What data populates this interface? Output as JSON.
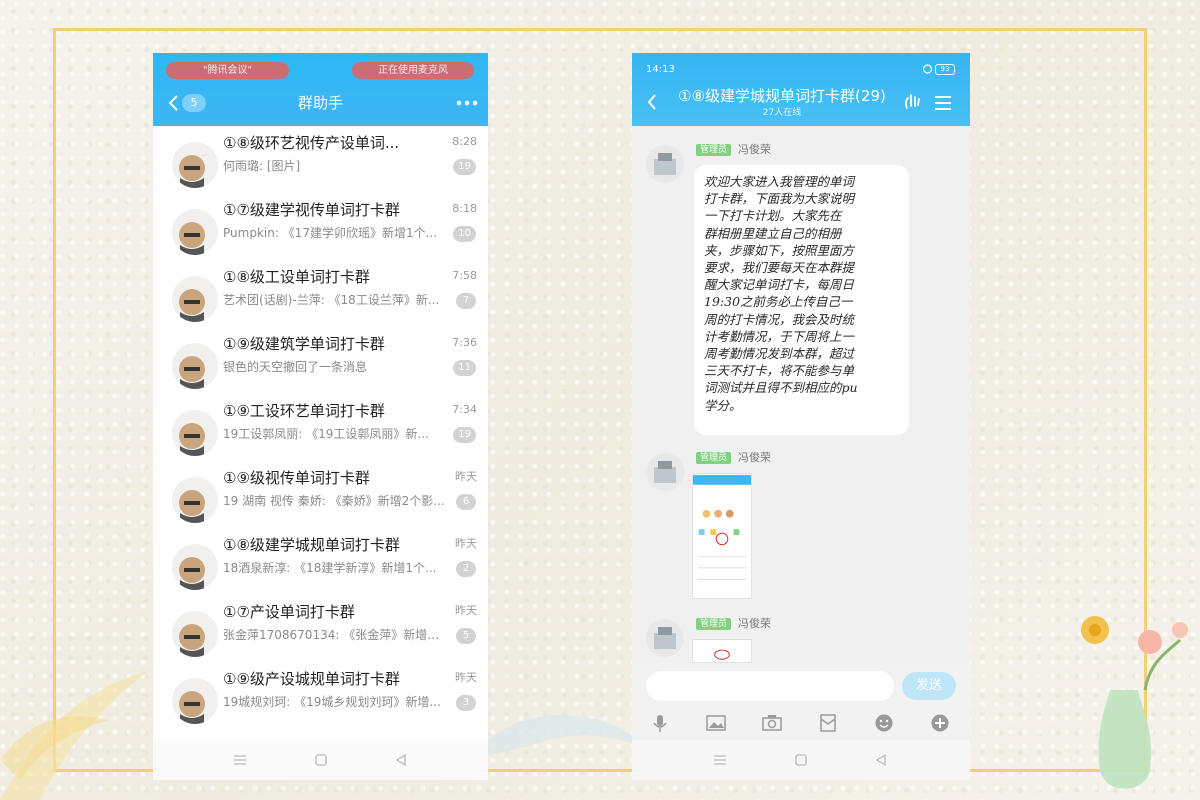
{
  "left_phone": {
    "header": {
      "pill_left": "\"腾讯会议\"",
      "pill_right": "正在使用麦克风",
      "back_badge": "5",
      "title": "群助手"
    },
    "conversations": [
      {
        "name": "①⑧级环艺视传产设单词...",
        "preview": "何雨璐: [图片]",
        "time": "8:28",
        "count": "19"
      },
      {
        "name": "①⑦级建学视传单词打卡群",
        "preview": "Pumpkin: 《17建学卯欣瑶》新增1个...",
        "time": "8:18",
        "count": "10"
      },
      {
        "name": "①⑧级工设单词打卡群",
        "preview": "艺术团(话剧)-兰萍: 《18工设兰萍》新...",
        "time": "7:58",
        "count": "7"
      },
      {
        "name": "①⑨级建筑学单词打卡群",
        "preview": "银色的天空撤回了一条消息",
        "time": "7:36",
        "count": "11"
      },
      {
        "name": "①⑨工设环艺单词打卡群",
        "preview": "19工设郭凤丽: 《19工设郭凤丽》新...",
        "time": "7:34",
        "count": "19"
      },
      {
        "name": "①⑨级视传单词打卡群",
        "preview": "19 湖南 视传 秦娇: 《秦娇》新增2个影...",
        "time": "昨天",
        "count": "6"
      },
      {
        "name": "①⑧级建学城规单词打卡群",
        "preview": "18酒泉新淳: 《18建学新淳》新增1个...",
        "time": "昨天",
        "count": "2"
      },
      {
        "name": "①⑦产设单词打卡群",
        "preview": "张金萍1708670134: 《张金萍》新增1个...",
        "time": "昨天",
        "count": "5"
      },
      {
        "name": "①⑨级产设城规单词打卡群",
        "preview": "19城规刘珂: 《19城乡规划刘珂》新增...",
        "time": "昨天",
        "count": "3"
      }
    ]
  },
  "right_phone": {
    "status": {
      "time": "14:13",
      "battery": "93"
    },
    "header": {
      "title": "①⑧级建学城规单词打卡群(29)",
      "online": "27人在线"
    },
    "messages": [
      {
        "role": "管理员",
        "sender": "冯俊荣",
        "lines": [
          "欢迎大家进入我管理的单词",
          "打卡群，下面我为大家说明",
          "一下打卡计划。大家先在",
          "群相册里建立自己的相册",
          "夹，步骤如下，按照里面方",
          "要求，我们要每天在本群提",
          "醒大家记单词打卡，每周日",
          "19:30之前务必上传自己一",
          "周的打卡情况，我会及时统",
          "计考勤情况，于下周将上一",
          "周考勤情况发到本群，超过",
          "三天不打卡，将不能参与单",
          "词测试并且得不到相应的pu",
          "学分。"
        ]
      },
      {
        "role": "管理员",
        "sender": "冯俊荣"
      },
      {
        "role": "管理员",
        "sender": "冯俊荣"
      }
    ],
    "send_label": "发送"
  },
  "colors": {
    "header_blue": "#3bb7f4",
    "badge_grey": "#d3d3d3",
    "admin_green": "#7fd27f"
  }
}
